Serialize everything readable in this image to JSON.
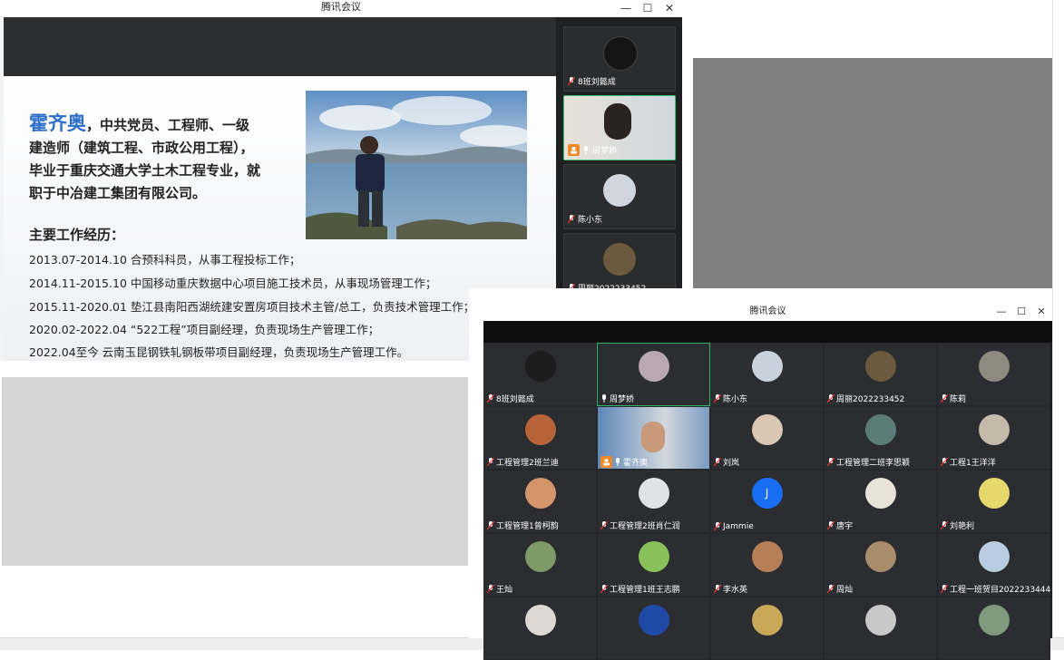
{
  "window1": {
    "title": "腾讯会议",
    "controls": {
      "minimize": "—",
      "maximize": "☐",
      "close": "✕"
    },
    "slide": {
      "name": "霍齐奥",
      "bio_lines": [
        "，中共党员、工程师、一级",
        "建造师（建筑工程、市政公用工程），",
        "毕业于重庆交通大学土木工程专业，就",
        "职于中冶建工集团有限公司。"
      ],
      "experience_title": "主要工作经历：",
      "experience": [
        "2013.07-2014.10  合预科科员，从事工程投标工作；",
        "2014.11-2015.10  中国移动重庆数据中心项目施工技术员，从事现场管理工作；",
        "2015.11-2020.01  垫江县南阳西湖统建安置房项目技术主管/总工，负责技术管理工作；",
        "2020.02-2022.04  “522工程”项目副经理，负责现场生产管理工作；",
        "2022.04至今  云南玉昆钢铁轧钢板带项目副经理，负责现场生产管理工作。"
      ]
    },
    "sidebar": [
      {
        "name": "8班刘懿成",
        "active": false
      },
      {
        "name": "周梦娇",
        "active": true
      },
      {
        "name": "陈小东",
        "active": false
      },
      {
        "name": "周丽2022233452",
        "active": false
      }
    ]
  },
  "window2": {
    "title": "腾讯会议",
    "controls": {
      "minimize": "—",
      "maximize": "☐",
      "close": "✕"
    },
    "participants": [
      {
        "name": "8班刘懿成",
        "color": "#1c1c1c"
      },
      {
        "name": "周梦娇",
        "color": "#b9a8b0",
        "active": true
      },
      {
        "name": "陈小东",
        "color": "#c9d1dc"
      },
      {
        "name": "周丽2022233452",
        "color": "#6b5a3e"
      },
      {
        "name": "陈莉",
        "color": "#8f8a7f"
      },
      {
        "name": "工程管理2班兰迪",
        "color": "#b8643a"
      },
      {
        "name": "霍齐奥",
        "color": "#6c8fb8",
        "video": true
      },
      {
        "name": "刘岚",
        "color": "#d9c7b3"
      },
      {
        "name": "工程管理二班李思颖",
        "color": "#5b7d79"
      },
      {
        "name": "工程1王洋洋",
        "color": "#c4b8aa"
      },
      {
        "name": "工程管理1曾柯韵",
        "color": "#d4956b"
      },
      {
        "name": "工程管理2班肖仁润",
        "color": "#dfe2e6"
      },
      {
        "name": "Jammie",
        "letter": "J",
        "color": "#1a6ef5"
      },
      {
        "name": "唐宇",
        "color": "#e8e2d8"
      },
      {
        "name": "刘艳利",
        "color": "#e6d76a"
      },
      {
        "name": "王灿",
        "color": "#7f9a66"
      },
      {
        "name": "工程管理1班王志鹏",
        "color": "#88c05a"
      },
      {
        "name": "李水英",
        "color": "#b77f55"
      },
      {
        "name": "周灿",
        "color": "#a88c6b"
      },
      {
        "name": "工程一班贺目2022233444",
        "color": "#b8cde0"
      },
      {
        "name": "",
        "color": "#ded8d2"
      },
      {
        "name": "",
        "color": "#1f4aa8"
      },
      {
        "name": "",
        "color": "#c9a85a"
      },
      {
        "name": "",
        "color": "#c8c8c8"
      },
      {
        "name": "",
        "color": "#7f9a7f"
      }
    ]
  }
}
